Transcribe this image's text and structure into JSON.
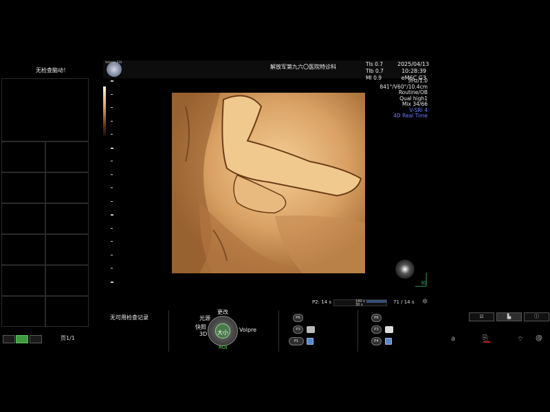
{
  "left_panel": {
    "title": "无检查脑动！",
    "page": "页1/1",
    "layout_buttons": [
      "single-layout",
      "four-layout",
      "six-layout"
    ]
  },
  "header": {
    "brand": "Voluson E10",
    "hospital": "解放军第九六〇医院特诊科",
    "params": [
      "TIs 0.7",
      "TIb 0.7",
      "MI 0.9"
    ],
    "date": "2025/04/13",
    "time": "10:28:39",
    "probe": "eM6C G3"
  },
  "probe_info": {
    "lines": [
      "5Hz/1.0",
      "841°/V60°/10.4cm",
      "Routine/OB",
      "Qual high1",
      "Mix 34/66"
    ],
    "mode_lines": [
      "V-SRI 4",
      "4D Real Time"
    ]
  },
  "axes_label": "3D",
  "cine": {
    "left": "P2: 14 s",
    "val1": "180 s",
    "val2": "30 s",
    "right": "71 / 14 s"
  },
  "bottom": {
    "no_records": "无可用检查记录",
    "knob_center": "大小",
    "labels": {
      "top": "更改",
      "left1": "光源",
      "left2": "快照",
      "left3": "3D",
      "right": "Volpre",
      "bottom": "ROI"
    }
  },
  "p_buttons": {
    "group1": [
      "P6",
      "P3",
      "P1"
    ],
    "group2": [
      "P6",
      "P3",
      "P4"
    ]
  },
  "status_icons": [
    "a"
  ],
  "colors": {
    "accent_green": "#3e9a3e",
    "roi_green": "#5fe15f",
    "mode_blue": "#6f7bff",
    "volume_tint": "#d9a46d"
  }
}
